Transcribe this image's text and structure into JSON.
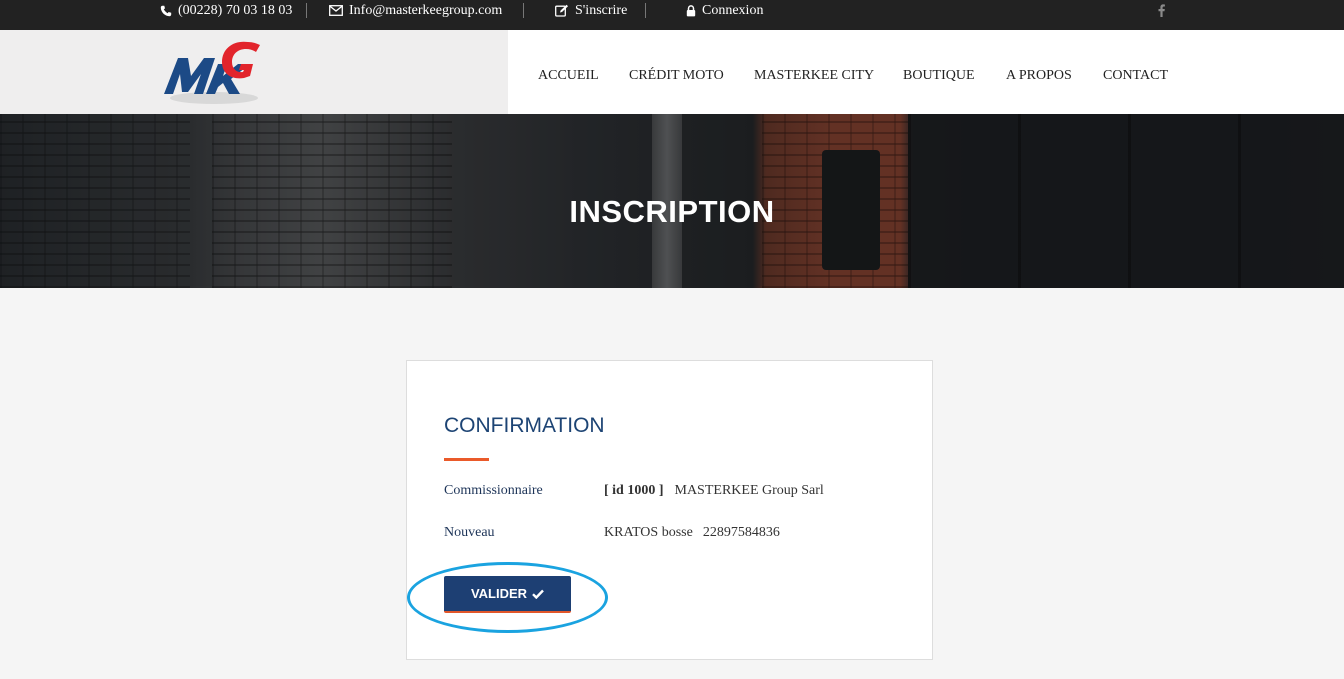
{
  "topbar": {
    "phone": "(00228) 70 03 18 03",
    "email": "Info@masterkeegroup.com",
    "register": "S'inscrire",
    "login": "Connexion",
    "social_icon": "facebook-icon"
  },
  "header": {
    "logo_icon": "mkg-logo",
    "nav": [
      {
        "label": "ACCUEIL"
      },
      {
        "label": "CRÉDIT MOTO"
      },
      {
        "label": "MASTERKEE CITY"
      },
      {
        "label": "BOUTIQUE"
      },
      {
        "label": "A PROPOS"
      },
      {
        "label": "CONTACT"
      }
    ]
  },
  "banner": {
    "title": "INSCRIPTION"
  },
  "card": {
    "title": "CONFIRMATION",
    "rows": [
      {
        "label": "Commissionnaire",
        "id": "[ id 1000 ]",
        "value": "MASTERKEE Group Sarl"
      },
      {
        "label": "Nouveau",
        "name": "KRATOS bosse",
        "phone": "22897584836"
      }
    ],
    "button_label": "VALIDER",
    "button_icon": "check-icon"
  },
  "colors": {
    "topbar_bg": "#222222",
    "brand_blue": "#1d3f73",
    "accent_orange": "#e2572a",
    "highlight_ring": "#1aa3e0"
  }
}
